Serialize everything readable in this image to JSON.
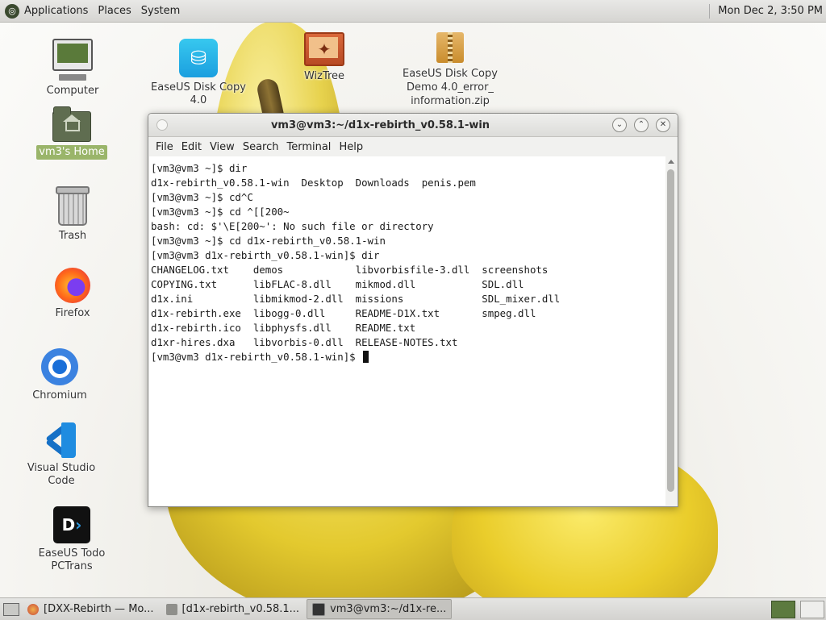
{
  "top_panel": {
    "menus": [
      "Applications",
      "Places",
      "System"
    ],
    "clock": "Mon Dec  2,  3:50 PM"
  },
  "desktop_icons": {
    "computer": "Computer",
    "home": "vm3's Home",
    "trash": "Trash",
    "firefox": "Firefox",
    "chromium": "Chromium",
    "vscode": "Visual Studio Code",
    "todo_pctrans": "EaseUS Todo PCTrans",
    "easeus_disk_copy": "EaseUS Disk Copy 4.0",
    "wiztree": "WizTree",
    "zip_file_lines": [
      "EaseUS Disk Copy",
      "Demo 4.0_error_",
      "information.zip"
    ]
  },
  "terminal": {
    "title": "vm3@vm3:~/d1x-rebirth_v0.58.1-win",
    "menu": [
      "File",
      "Edit",
      "View",
      "Search",
      "Terminal",
      "Help"
    ],
    "lines": [
      "[vm3@vm3 ~]$ dir",
      "d1x-rebirth_v0.58.1-win  Desktop  Downloads  penis.pem",
      "[vm3@vm3 ~]$ cd^C",
      "[vm3@vm3 ~]$ cd ^[[200~",
      "bash: cd: $'\\E[200~': No such file or directory",
      "[vm3@vm3 ~]$ cd d1x-rebirth_v0.58.1-win",
      "[vm3@vm3 d1x-rebirth_v0.58.1-win]$ dir",
      "CHANGELOG.txt    demos            libvorbisfile-3.dll  screenshots",
      "COPYING.txt      libFLAC-8.dll    mikmod.dll           SDL.dll",
      "d1x.ini          libmikmod-2.dll  missions             SDL_mixer.dll",
      "d1x-rebirth.exe  libogg-0.dll     README-D1X.txt       smpeg.dll",
      "d1x-rebirth.ico  libphysfs.dll    README.txt",
      "d1xr-hires.dxa   libvorbis-0.dll  RELEASE-NOTES.txt"
    ],
    "prompt": "[vm3@vm3 d1x-rebirth_v0.58.1-win]$ "
  },
  "taskbar": {
    "tasks": [
      {
        "label": "[DXX-Rebirth — Mo...",
        "icon": "firefox-icon"
      },
      {
        "label": "[d1x-rebirth_v0.58.1...",
        "icon": "folder-icon"
      },
      {
        "label": "vm3@vm3:~/d1x-re...",
        "icon": "terminal-icon"
      }
    ]
  }
}
